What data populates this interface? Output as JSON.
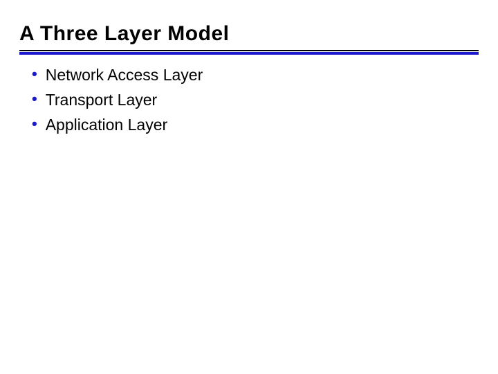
{
  "slide": {
    "title": "A Three Layer Model",
    "bullets": [
      "Network Access Layer",
      "Transport Layer",
      "Application Layer"
    ]
  }
}
